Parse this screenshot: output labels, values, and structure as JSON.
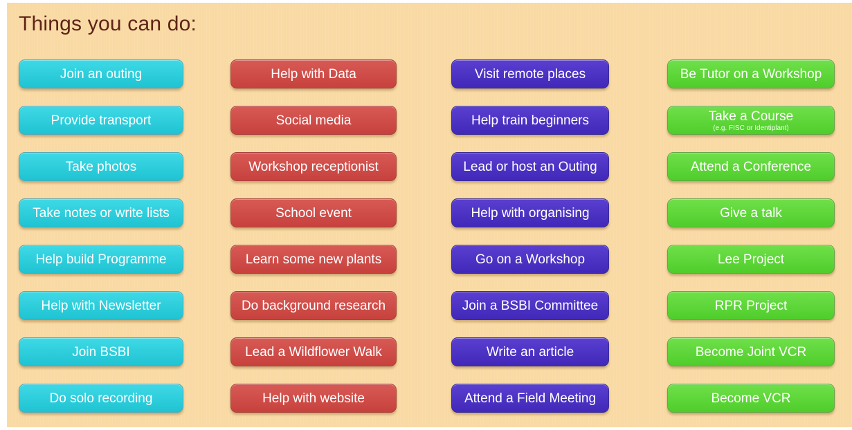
{
  "title": "Things you can do:",
  "colors": {
    "background": "#f9daa4",
    "title": "#5e2418",
    "column_1": "#1fc3d2",
    "column_2": "#c7413d",
    "column_3": "#4128b8",
    "column_4": "#4fcd2b"
  },
  "columns": [
    {
      "items": [
        {
          "label": "Join an outing"
        },
        {
          "label": "Provide transport"
        },
        {
          "label": "Take photos"
        },
        {
          "label": "Take notes or write lists"
        },
        {
          "label": "Help build Programme"
        },
        {
          "label": "Help with Newsletter"
        },
        {
          "label": "Join BSBI"
        },
        {
          "label": "Do solo recording"
        }
      ]
    },
    {
      "items": [
        {
          "label": "Help with Data"
        },
        {
          "label": "Social media"
        },
        {
          "label": "Workshop receptionist"
        },
        {
          "label": "School event"
        },
        {
          "label": "Learn some new plants"
        },
        {
          "label": "Do background research"
        },
        {
          "label": "Lead a Wildflower Walk"
        },
        {
          "label": "Help with website"
        }
      ]
    },
    {
      "items": [
        {
          "label": "Visit remote places"
        },
        {
          "label": "Help train beginners"
        },
        {
          "label": "Lead or host an Outing"
        },
        {
          "label": "Help with organising"
        },
        {
          "label": "Go on a Workshop"
        },
        {
          "label": "Join a BSBI Committee"
        },
        {
          "label": "Write an article"
        },
        {
          "label": "Attend a Field Meeting"
        }
      ]
    },
    {
      "items": [
        {
          "label": "Be Tutor on a Workshop"
        },
        {
          "label": "Take a Course",
          "sublabel": "(e.g. FISC or Identiplant)"
        },
        {
          "label": "Attend a Conference"
        },
        {
          "label": "Give a talk"
        },
        {
          "label": "Lee Project"
        },
        {
          "label": "RPR Project"
        },
        {
          "label": "Become Joint VCR"
        },
        {
          "label": "Become VCR"
        }
      ]
    }
  ]
}
